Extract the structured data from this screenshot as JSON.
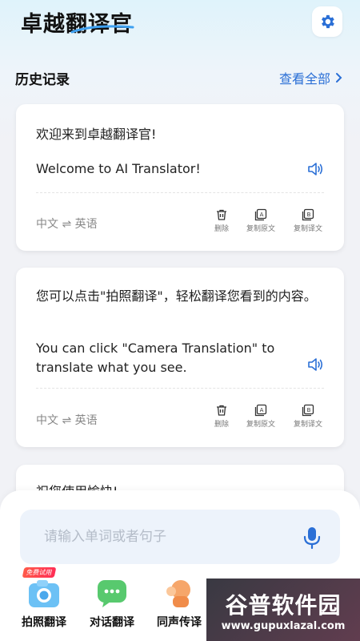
{
  "app": {
    "title": "卓越翻译官",
    "accent_color": "#2a6fd6"
  },
  "header": {
    "settings_icon": "gear-icon"
  },
  "history": {
    "section_title": "历史记录",
    "view_all_label": "查看全部",
    "action_labels": {
      "delete": "删除",
      "copy_source": "复制原文",
      "copy_translation": "复制译文"
    },
    "items": [
      {
        "source": "欢迎来到卓越翻译官!",
        "target": "Welcome to AI Translator!",
        "lang_from": "中文",
        "lang_to": "英语"
      },
      {
        "source": "您可以点击\"拍照翻译\"，轻松翻译您看到的内容。",
        "target": "You can click \"Camera Translation\" to translate what you see.",
        "lang_from": "中文",
        "lang_to": "英语"
      },
      {
        "source": "祝您使用愉快!"
      }
    ]
  },
  "input": {
    "placeholder": "请输入单词或者句子",
    "value": ""
  },
  "features": [
    {
      "label": "拍照翻译",
      "badge": "免费试用",
      "icon": "camera-icon"
    },
    {
      "label": "对话翻译",
      "icon": "chat-icon"
    },
    {
      "label": "同声传译",
      "icon": "interpreter-icon"
    }
  ],
  "watermark": {
    "name": "谷普软件园",
    "url": "www.gupuxlazal.com"
  }
}
